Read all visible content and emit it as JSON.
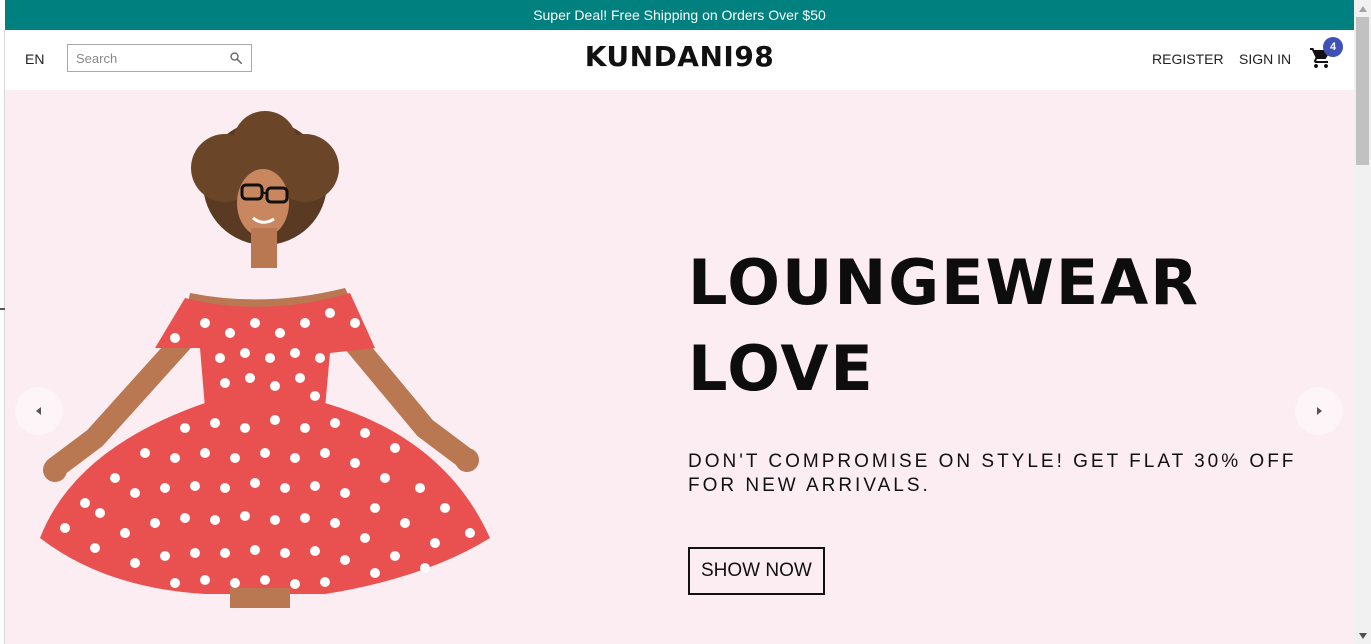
{
  "announcement": {
    "text": "Super Deal! Free Shipping on Orders Over $50"
  },
  "navbar": {
    "language": "EN",
    "search": {
      "placeholder": "Search",
      "value": ""
    },
    "logo": "KUNDANI98",
    "links": {
      "register": "REGISTER",
      "sign_in": "SIGN IN"
    },
    "cart": {
      "count": "4"
    }
  },
  "hero": {
    "title": "LOUNGEWEAR LOVE",
    "description": "DON'T COMPROMISE ON STYLE! GET FLAT 30% OFF FOR NEW ARRIVALS.",
    "button": "SHOW NOW"
  },
  "icons": [
    "search-icon",
    "cart-icon",
    "chevron-left-icon",
    "chevron-right-icon"
  ],
  "colors": {
    "announcement_bg": "#00807f",
    "hero_bg": "#fbedf2",
    "badge": "#3f51b5",
    "dress": "#e8514f"
  }
}
